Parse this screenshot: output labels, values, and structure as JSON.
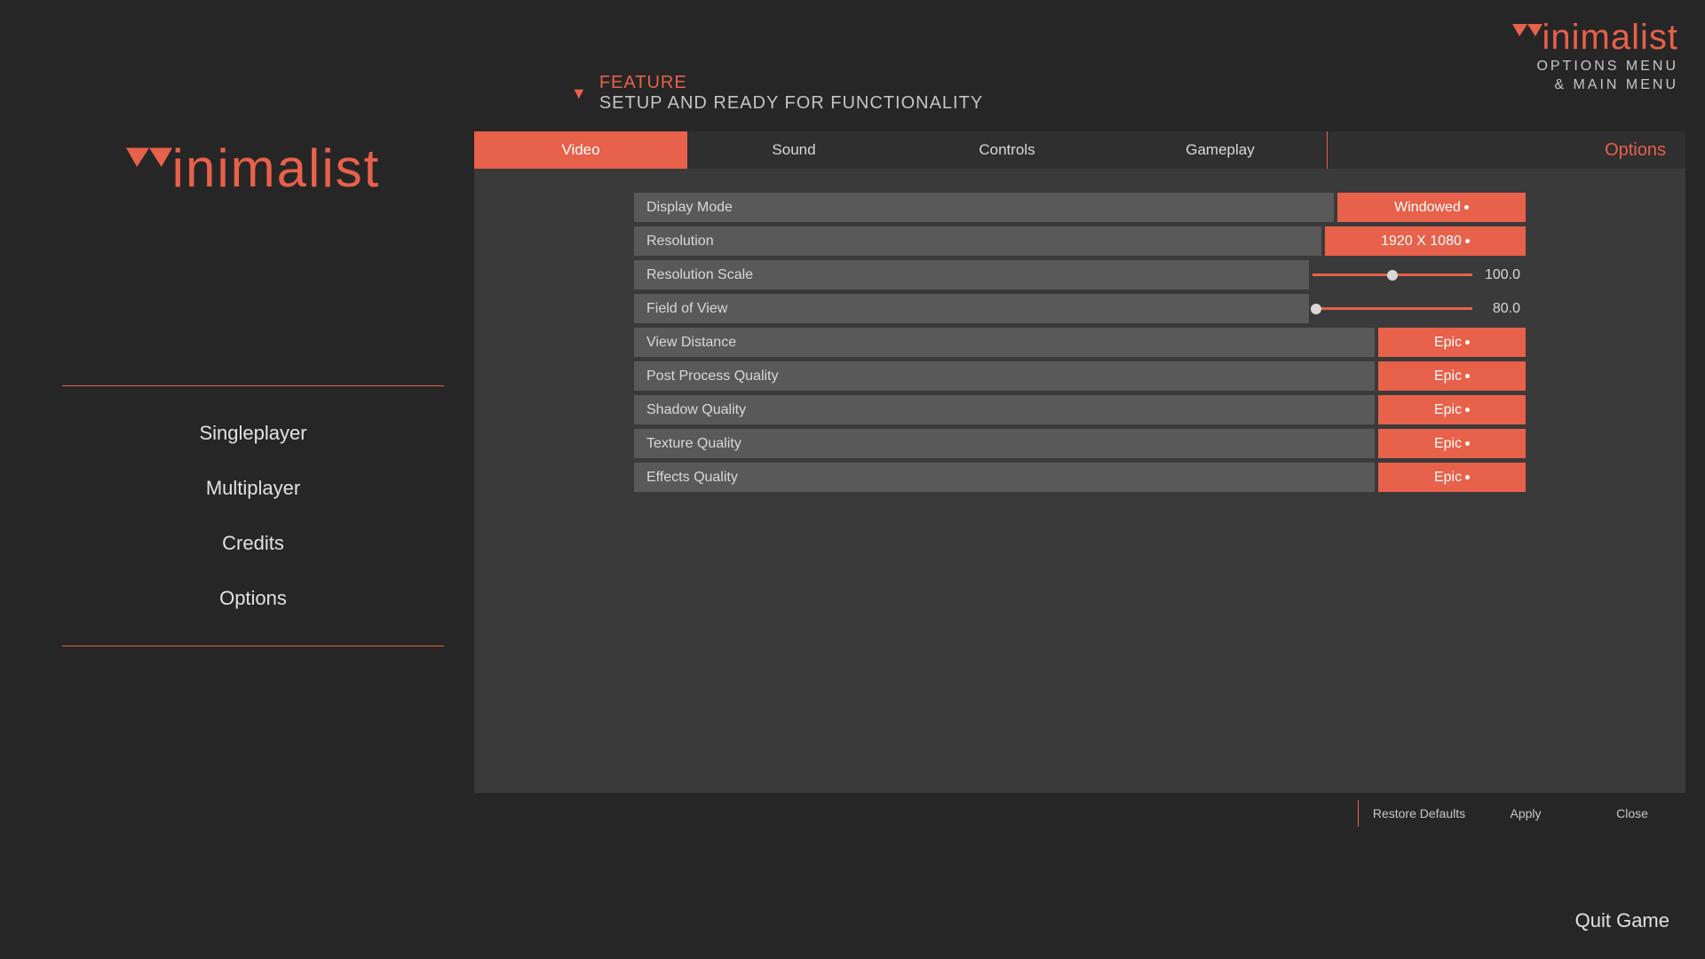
{
  "brand": "inimalist",
  "top_right": {
    "line1": "OPTIONS MENU",
    "line2": "& MAIN MENU"
  },
  "feature": {
    "label": "FEATURE",
    "subtitle": "SETUP AND READY FOR FUNCTIONALITY"
  },
  "main_menu": {
    "items": [
      "Singleplayer",
      "Multiplayer",
      "Credits",
      "Options"
    ]
  },
  "options": {
    "title": "Options",
    "tabs": [
      "Video",
      "Sound",
      "Controls",
      "Gameplay"
    ],
    "active_tab": "Video",
    "settings": [
      {
        "label": "Display Mode",
        "type": "dropdown",
        "value": "Windowed",
        "width": "normal"
      },
      {
        "label": "Resolution",
        "type": "dropdown",
        "value": "1920 X 1080",
        "width": "wide"
      },
      {
        "label": "Resolution Scale",
        "type": "slider",
        "value": "100.0",
        "pct": 50
      },
      {
        "label": "Field of View",
        "type": "slider",
        "value": "80.0",
        "pct": 2
      },
      {
        "label": "View Distance",
        "type": "dropdown",
        "value": "Epic",
        "width": "narrow"
      },
      {
        "label": "Post Process Quality",
        "type": "dropdown",
        "value": "Epic",
        "width": "narrow"
      },
      {
        "label": "Shadow Quality",
        "type": "dropdown",
        "value": "Epic",
        "width": "narrow"
      },
      {
        "label": "Texture Quality",
        "type": "dropdown",
        "value": "Epic",
        "width": "narrow"
      },
      {
        "label": "Effects Quality",
        "type": "dropdown",
        "value": "Epic",
        "width": "narrow"
      }
    ],
    "footer": [
      "Restore Defaults",
      "Apply",
      "Close"
    ]
  },
  "quit": "Quit Game"
}
